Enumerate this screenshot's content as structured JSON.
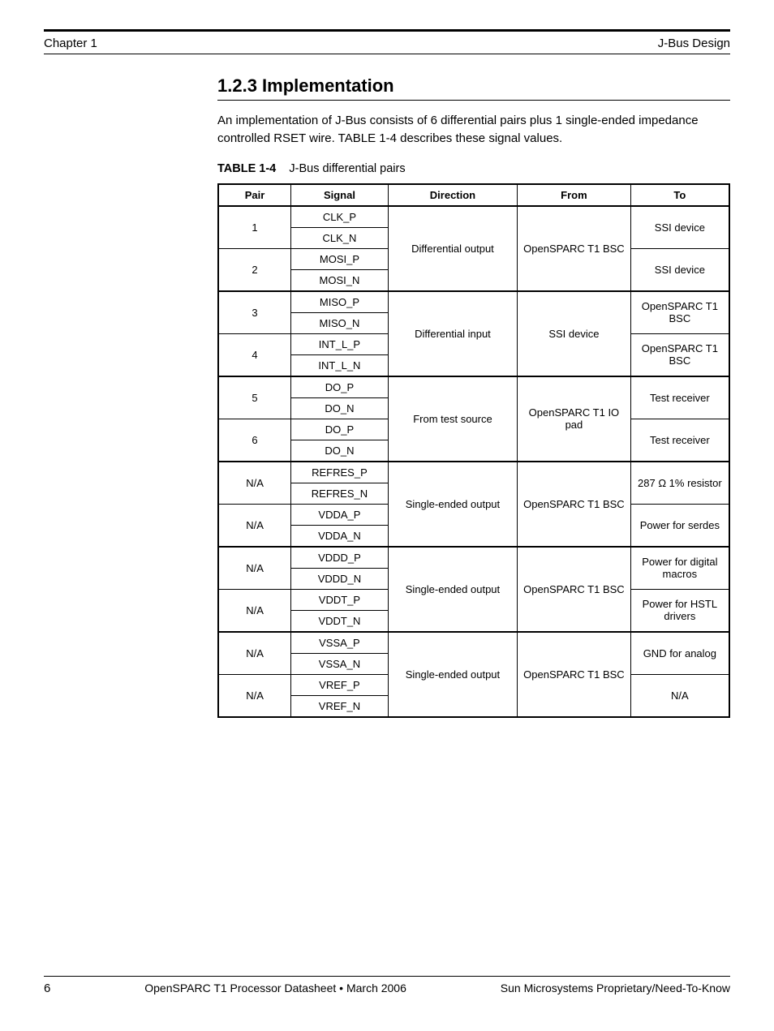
{
  "header": {
    "left": "Chapter 1",
    "right": "J-Bus Design"
  },
  "section": {
    "title": "1.2.3 Implementation",
    "paragraph": "An implementation of J-Bus consists of 6 differential pairs plus 1 single-ended impedance controlled RSET wire. TABLE 1-4 describes these signal values."
  },
  "table": {
    "caption_label": "TABLE 1-4",
    "caption_text": "J-Bus differential pairs",
    "headers": [
      "Pair",
      "Signal",
      "Direction",
      "From",
      "To"
    ],
    "groups": [
      {
        "rows": [
          {
            "pair": "1",
            "sigA": "CLK_P",
            "sigB": "CLK_N",
            "direction": "Differential output",
            "from": "OpenSPARC T1 BSC",
            "to": "SSI device"
          },
          {
            "pair": "2",
            "sigA": "MOSI_P",
            "sigB": "MOSI_N",
            "direction": "Differential output",
            "from": "OpenSPARC T1 BSC",
            "to": "SSI device"
          }
        ]
      },
      {
        "rows": [
          {
            "pair": "3",
            "sigA": "MISO_P",
            "sigB": "MISO_N",
            "direction": "Differential input",
            "from": "SSI device",
            "to": "OpenSPARC T1 BSC"
          },
          {
            "pair": "4",
            "sigA": "INT_L_P",
            "sigB": "INT_L_N",
            "direction": "Differential input",
            "from": "SSI device",
            "to": "OpenSPARC T1 BSC"
          }
        ]
      },
      {
        "rows": [
          {
            "pair": "5",
            "sigA": "DO_P",
            "sigB": "DO_N",
            "direction": "From test source",
            "from": "OpenSPARC T1 IO pad",
            "to": "Test receiver"
          },
          {
            "pair": "6",
            "sigA": "DO_P",
            "sigB": "DO_N",
            "direction": "From test source",
            "from": "OpenSPARC T1 IO pad",
            "to": "Test receiver"
          }
        ]
      },
      {
        "rows": [
          {
            "pair": "N/A",
            "sigA": "REFRES_P",
            "sigB": "REFRES_N",
            "direction": "Single-ended output",
            "from": "OpenSPARC T1 BSC",
            "to": "287 Ω  1% resistor"
          },
          {
            "pair": "N/A",
            "sigA": "VDDA_P",
            "sigB": "VDDA_N",
            "direction": "Single-ended output",
            "from": "OpenSPARC T1 BSC",
            "to": "Power for serdes"
          }
        ]
      },
      {
        "rows": [
          {
            "pair": "N/A",
            "sigA": "VDDD_P",
            "sigB": "VDDD_N",
            "direction": "Single-ended output",
            "from": "OpenSPARC T1 BSC",
            "to": "Power for digital macros"
          },
          {
            "pair": "N/A",
            "sigA": "VDDT_P",
            "sigB": "VDDT_N",
            "direction": "Single-ended output",
            "from": "OpenSPARC T1 BSC",
            "to": "Power for HSTL drivers"
          }
        ]
      },
      {
        "rows": [
          {
            "pair": "N/A",
            "sigA": "VSSA_P",
            "sigB": "VSSA_N",
            "direction": "Single-ended output",
            "from": "OpenSPARC T1 BSC",
            "to": "GND for analog"
          },
          {
            "pair": "N/A",
            "sigA": "VREF_P",
            "sigB": "VREF_N",
            "direction": "Single-ended output",
            "from": "OpenSPARC T1 BSC",
            "to": "N/A"
          }
        ]
      }
    ]
  },
  "footer": {
    "left": "6",
    "mid": "",
    "right": "Sun Microsystems Proprietary/Need-To-Know",
    "title_left": "OpenSPARC T1 Processor Datasheet • March 2006"
  }
}
